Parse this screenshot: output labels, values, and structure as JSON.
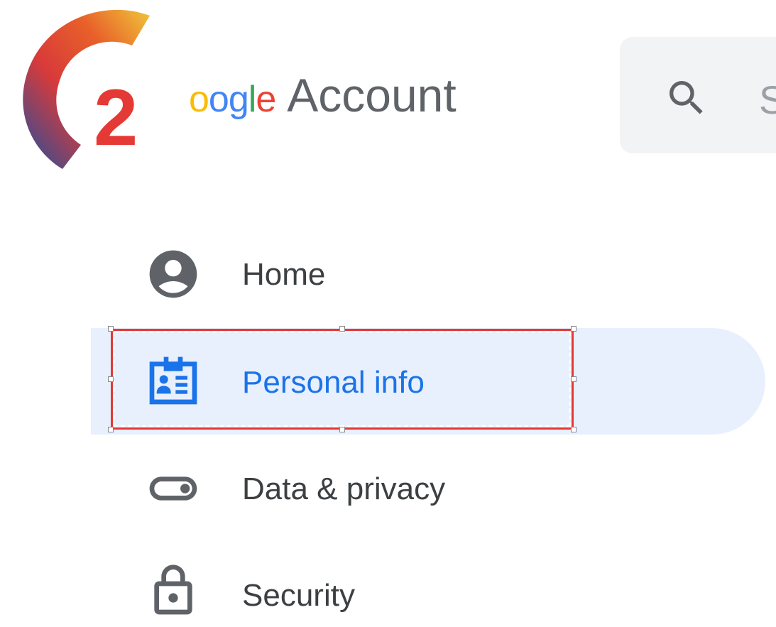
{
  "header": {
    "brand_partial": "oogle",
    "product_name": "Account",
    "badge_number": "2"
  },
  "search": {
    "placeholder_visible": "S",
    "icon": "search-icon"
  },
  "nav": {
    "items": [
      {
        "label": "Home",
        "icon": "account-circle-icon",
        "selected": false
      },
      {
        "label": "Personal info",
        "icon": "id-card-icon",
        "selected": true
      },
      {
        "label": "Data & privacy",
        "icon": "toggle-icon",
        "selected": false
      },
      {
        "label": "Security",
        "icon": "lock-icon",
        "selected": false
      }
    ]
  },
  "colors": {
    "selected_bg": "#e8f0fe",
    "selected_text": "#1a73e8",
    "default_text": "#3c4043",
    "icon_gray": "#5f6368",
    "highlight_border": "#e53935"
  }
}
